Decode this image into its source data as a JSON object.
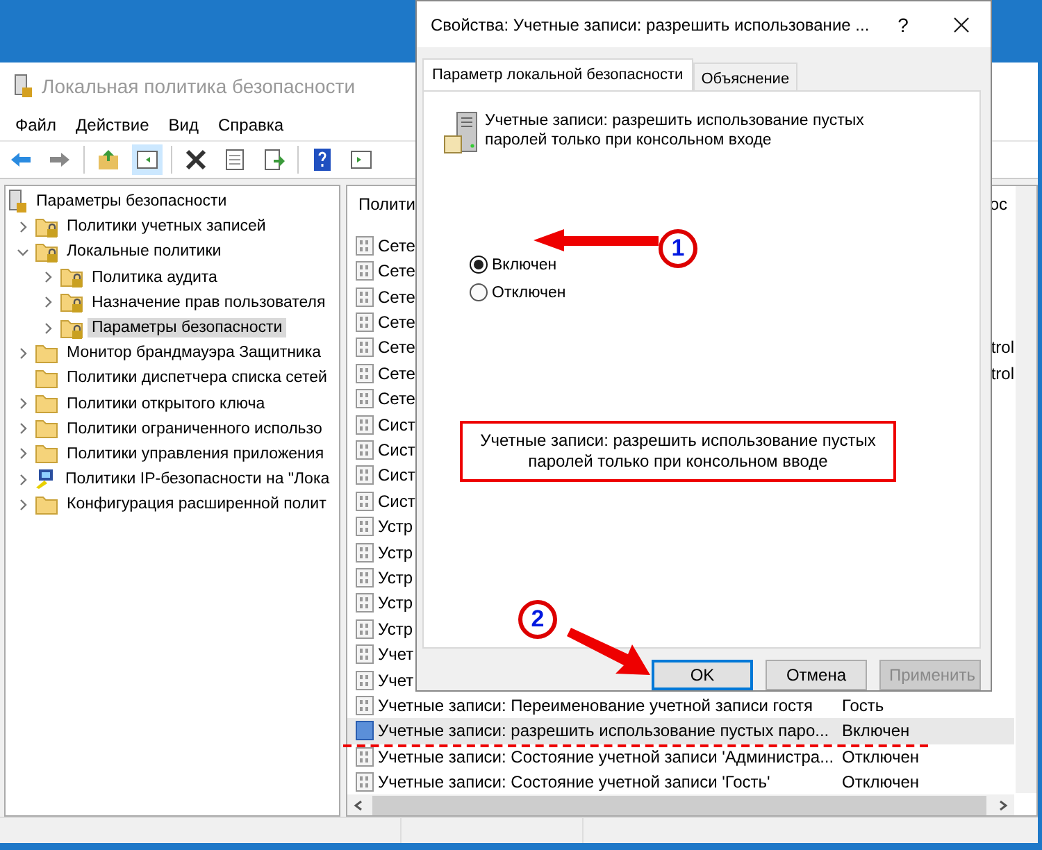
{
  "main_window": {
    "title": "Локальная политика безопасности",
    "menu": [
      "Файл",
      "Действие",
      "Вид",
      "Справка"
    ]
  },
  "tree": {
    "root": "Параметры безопасности",
    "items": [
      {
        "label": "Политики учетных записей",
        "kind": "secure-folder",
        "expanded": false,
        "selected": false
      },
      {
        "label": "Локальные политики",
        "kind": "secure-folder",
        "expanded": true,
        "selected": false,
        "children": [
          {
            "label": "Политика аудита",
            "kind": "secure-folder",
            "expanded": false,
            "selected": false
          },
          {
            "label": "Назначение прав пользователя",
            "kind": "secure-folder",
            "expanded": false,
            "selected": false
          },
          {
            "label": "Параметры безопасности",
            "kind": "secure-folder",
            "expanded": false,
            "selected": true
          }
        ]
      },
      {
        "label": "Монитор брандмауэра Защитника",
        "kind": "folder",
        "expanded": false,
        "selected": false
      },
      {
        "label": "Политики диспетчера списка сетей",
        "kind": "leaf-folder",
        "selected": false
      },
      {
        "label": "Политики открытого ключа",
        "kind": "folder",
        "expanded": false,
        "selected": false
      },
      {
        "label": "Политики ограниченного использо",
        "kind": "folder",
        "expanded": false,
        "selected": false
      },
      {
        "label": "Политики управления приложения",
        "kind": "folder",
        "expanded": false,
        "selected": false
      },
      {
        "label": "Политики IP-безопасности на \"Лока",
        "kind": "ip-policy",
        "expanded": false,
        "selected": false
      },
      {
        "label": "Конфигурация расширенной полит",
        "kind": "folder",
        "expanded": false,
        "selected": false
      }
    ]
  },
  "list": {
    "columns": [
      "Полити",
      "ос"
    ],
    "rows": [
      {
        "kind": "covered",
        "name": "Сете",
        "selected": false
      },
      {
        "kind": "covered",
        "name": "Сете",
        "selected": false
      },
      {
        "kind": "covered",
        "name": "Сете",
        "selected": false
      },
      {
        "kind": "covered",
        "name": "Сете",
        "selected": false
      },
      {
        "kind": "covered",
        "name": "Сете",
        "value": "trol",
        "selected": false
      },
      {
        "kind": "covered",
        "name": "Сете",
        "value": "trol",
        "selected": false
      },
      {
        "kind": "covered",
        "name": "Сете",
        "selected": false
      },
      {
        "kind": "covered",
        "name": "Сист",
        "selected": false
      },
      {
        "kind": "covered",
        "name": "Сист",
        "selected": false
      },
      {
        "kind": "covered",
        "name": "Сист",
        "selected": false
      },
      {
        "kind": "covered",
        "name": "Сист",
        "selected": false
      },
      {
        "kind": "covered",
        "name": "Устр",
        "selected": false
      },
      {
        "kind": "covered",
        "name": "Устр",
        "selected": false
      },
      {
        "kind": "covered",
        "name": "Устр",
        "selected": false
      },
      {
        "kind": "covered",
        "name": "Устр",
        "selected": false
      },
      {
        "kind": "covered",
        "name": "Устр",
        "selected": false
      },
      {
        "kind": "covered",
        "name": "Учет",
        "selected": false
      },
      {
        "kind": "covered",
        "name": "Учет",
        "selected": false
      },
      {
        "kind": "full",
        "name": "Учетные записи: Переименование учетной записи гостя",
        "value": "Гость",
        "selected": false
      },
      {
        "kind": "full",
        "name": "Учетные записи: разрешить использование пустых паро...",
        "value": "Включен",
        "selected": true
      },
      {
        "kind": "full",
        "name": "Учетные записи: Состояние учетной записи 'Администра...",
        "value": "Отключен",
        "selected": false
      },
      {
        "kind": "full",
        "name": "Учетные записи: Состояние учетной записи 'Гость'",
        "value": "Отключен",
        "selected": false
      }
    ]
  },
  "dialog": {
    "title": "Свойства: Учетные записи: разрешить использование ...",
    "help": "?",
    "tabs": [
      {
        "label": "Параметр локальной безопасности",
        "selected": true
      },
      {
        "label": "Объяснение",
        "selected": false
      }
    ],
    "description": "Учетные записи: разрешить использование пустых паролей только при консольном входе",
    "options": [
      {
        "label": "Включен",
        "selected": true
      },
      {
        "label": "Отключен",
        "selected": false
      }
    ],
    "buttons": [
      {
        "label": "OK",
        "default": true,
        "disabled": false
      },
      {
        "label": "Отмена",
        "default": false,
        "disabled": false
      },
      {
        "label": "Применить",
        "default": false,
        "disabled": true
      }
    ]
  },
  "annotations": {
    "callout": "Учетные записи: разрешить использование пустых паролей только при консольном вводе",
    "markers": [
      "1",
      "2"
    ]
  }
}
